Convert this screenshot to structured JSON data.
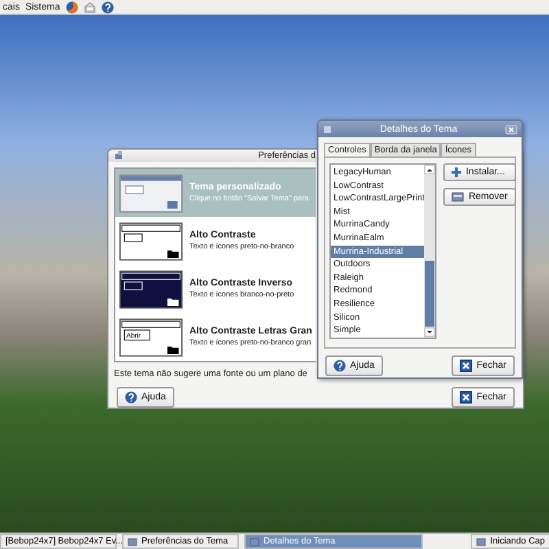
{
  "top_panel": {
    "menus": [
      "cais",
      "Sistema"
    ]
  },
  "preferences_window": {
    "title": "Preferências d",
    "themes": [
      {
        "kind": "custom",
        "name": "Tema personalizado",
        "description": "Clique no botão \"Salvar Tema\" para",
        "selected": true
      },
      {
        "kind": "high-contrast",
        "name": "Alto Contraste",
        "description": "Texto e ícones preto-no-branco",
        "selected": false
      },
      {
        "kind": "inverse",
        "name": "Alto Contraste Inverso",
        "description": "Texto e ícones branco-no-preto",
        "selected": false
      },
      {
        "kind": "large",
        "name": "Alto Contraste Letras Gran",
        "description": "Texto e ícones preto-no-branco gran",
        "selected": false,
        "thumb_button": "Abrir"
      }
    ],
    "note": "Este tema não sugere uma fonte ou um plano de",
    "help_button": "Ajuda",
    "close_button": "Fechar"
  },
  "details_window": {
    "title": "Detalhes do Tema",
    "tabs": [
      {
        "label": "Controles",
        "selected": true
      },
      {
        "label": "Borda da janela",
        "selected": false
      },
      {
        "label": "Ícones",
        "selected": false
      }
    ],
    "themes": [
      {
        "name": "LegacyHuman",
        "selected": false
      },
      {
        "name": "LowContrast",
        "selected": false
      },
      {
        "name": "LowContrastLargePrint",
        "selected": false
      },
      {
        "name": "Mist",
        "selected": false
      },
      {
        "name": "MurrinaCandy",
        "selected": false
      },
      {
        "name": "MurrinaEalm",
        "selected": false
      },
      {
        "name": "Murrina-Industrial",
        "selected": true
      },
      {
        "name": "Outdoors",
        "selected": false
      },
      {
        "name": "Raleigh",
        "selected": false
      },
      {
        "name": "Redmond",
        "selected": false
      },
      {
        "name": "Resilience",
        "selected": false
      },
      {
        "name": "Silicon",
        "selected": false
      },
      {
        "name": "Simple",
        "selected": false
      }
    ],
    "install_button": "Instalar...",
    "remove_button": "Remover",
    "help_button": "Ajuda",
    "close_button": "Fechar"
  },
  "taskbar": {
    "items": [
      {
        "label": "[Bebop24x7] Bebop24x7 Ev...",
        "selected": false
      },
      {
        "label": "Preferências do Tema",
        "selected": false
      },
      {
        "label": "Detalhes do Tema",
        "selected": true
      },
      {
        "label": "Iniciando Cap",
        "selected": false
      }
    ]
  }
}
